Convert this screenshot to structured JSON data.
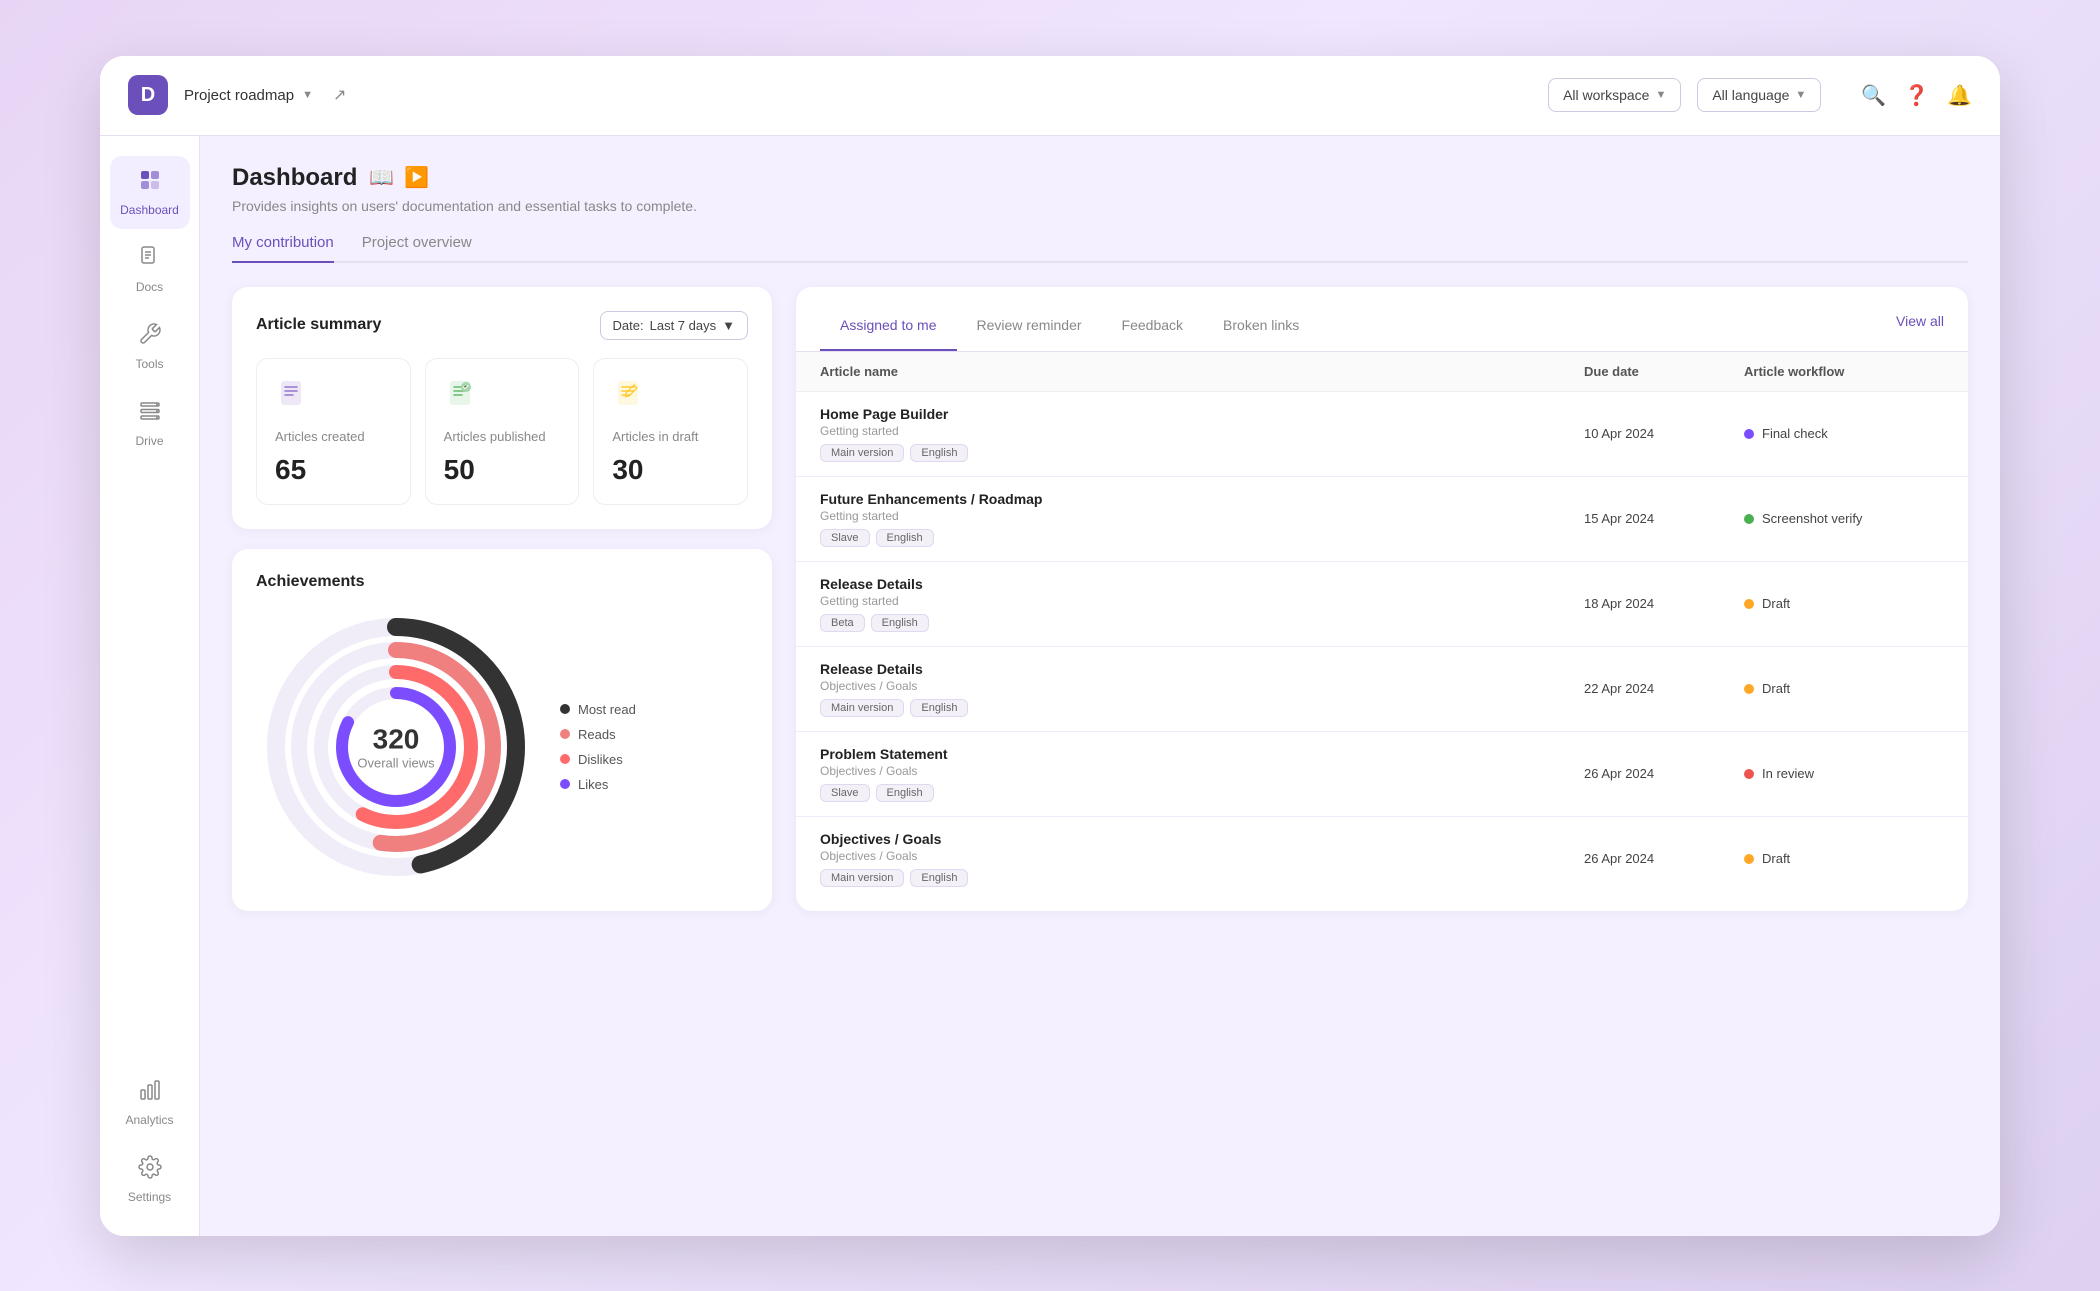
{
  "topbar": {
    "logo": "D",
    "project_name": "Project roadmap",
    "filters": [
      {
        "label": "All workspace",
        "id": "workspace-filter"
      },
      {
        "label": "All language",
        "id": "language-filter"
      }
    ]
  },
  "sidebar": {
    "items": [
      {
        "id": "dashboard",
        "label": "Dashboard",
        "icon": "🏠",
        "active": true
      },
      {
        "id": "docs",
        "label": "Docs",
        "icon": "📚",
        "active": false
      },
      {
        "id": "tools",
        "label": "Tools",
        "icon": "🔧",
        "active": false
      },
      {
        "id": "drive",
        "label": "Drive",
        "icon": "🗄️",
        "active": false
      },
      {
        "id": "analytics",
        "label": "Analytics",
        "icon": "📊",
        "active": false
      },
      {
        "id": "settings",
        "label": "Settings",
        "icon": "⚙️",
        "active": false
      }
    ]
  },
  "page": {
    "title": "Dashboard",
    "subtitle": "Provides insights on users' documentation and essential tasks to complete."
  },
  "tabs": [
    {
      "id": "my-contribution",
      "label": "My contribution",
      "active": true
    },
    {
      "id": "project-overview",
      "label": "Project overview",
      "active": false
    }
  ],
  "article_summary": {
    "title": "Article summary",
    "date_label": "Date:",
    "date_value": "Last 7 days",
    "stats": [
      {
        "label": "Articles created",
        "value": "65",
        "icon_color": "#b39ddb"
      },
      {
        "label": "Articles published",
        "value": "50",
        "icon_color": "#a5d6a7"
      },
      {
        "label": "Articles in draft",
        "value": "30",
        "icon_color": "#ffe082"
      }
    ]
  },
  "achievements": {
    "title": "Achievements",
    "overall_views_value": "320",
    "overall_views_label": "Overall views",
    "legend": [
      {
        "label": "Most read",
        "color": "#333333"
      },
      {
        "label": "Reads",
        "color": "#f08080"
      },
      {
        "label": "Dislikes",
        "color": "#ff6b6b"
      },
      {
        "label": "Likes",
        "color": "#7c4dff"
      }
    ]
  },
  "panel": {
    "tabs": [
      {
        "id": "assigned-to-me",
        "label": "Assigned to me",
        "active": true
      },
      {
        "id": "review-reminder",
        "label": "Review reminder",
        "active": false
      },
      {
        "id": "feedback",
        "label": "Feedback",
        "active": false
      },
      {
        "id": "broken-links",
        "label": "Broken links",
        "active": false
      }
    ],
    "view_all": "View all",
    "table_headers": {
      "article_name": "Article name",
      "due_date": "Due date",
      "article_workflow": "Article workflow"
    },
    "rows": [
      {
        "name": "Home Page Builder",
        "category": "Getting started",
        "tags": [
          "Main version",
          "English"
        ],
        "due_date": "10 Apr 2024",
        "workflow": "Final check",
        "workflow_color": "#7c4dff",
        "workflow_dot_type": "purple"
      },
      {
        "name": "Future Enhancements / Roadmap",
        "category": "Getting started",
        "tags": [
          "Slave",
          "English"
        ],
        "due_date": "15 Apr 2024",
        "workflow": "Screenshot verify",
        "workflow_color": "#4caf50",
        "workflow_dot_type": "green"
      },
      {
        "name": "Release Details",
        "category": "Getting started",
        "tags": [
          "Beta",
          "English"
        ],
        "due_date": "18 Apr 2024",
        "workflow": "Draft",
        "workflow_color": "#ffa726",
        "workflow_dot_type": "orange"
      },
      {
        "name": "Release Details",
        "category": "Objectives / Goals",
        "tags": [
          "Main version",
          "English"
        ],
        "due_date": "22 Apr 2024",
        "workflow": "Draft",
        "workflow_color": "#ffa726",
        "workflow_dot_type": "orange"
      },
      {
        "name": "Problem Statement",
        "category": "Objectives / Goals",
        "tags": [
          "Slave",
          "English"
        ],
        "due_date": "26 Apr 2024",
        "workflow": "In review",
        "workflow_color": "#ef5350",
        "workflow_dot_type": "red"
      },
      {
        "name": "Objectives / Goals",
        "category": "Objectives / Goals",
        "tags": [
          "Main version",
          "English"
        ],
        "due_date": "26 Apr 2024",
        "workflow": "Draft",
        "workflow_color": "#ffa726",
        "workflow_dot_type": "orange"
      }
    ]
  }
}
